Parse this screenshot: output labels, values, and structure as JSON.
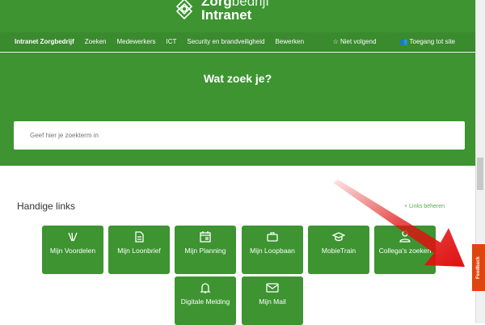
{
  "header": {
    "logo_bold": "Zorg",
    "logo_light": "bedrijf",
    "logo_line2": "Intranet"
  },
  "nav": {
    "brand": "Intranet Zorgbedrijf",
    "items": [
      "Zoeken",
      "Medewerkers",
      "ICT",
      "Security en brandveiligheid",
      "Bewerken"
    ],
    "follow": "Niet volgend",
    "access": "Toegang tot site"
  },
  "hero": {
    "title": "Wat zoek je?",
    "search_placeholder": "Geef hier je zoekterm in"
  },
  "links": {
    "title": "Handige links",
    "manage": "+ Links beheren",
    "tiles": [
      {
        "label": "Mijn Voordelen",
        "icon": "cards-icon"
      },
      {
        "label": "Mijn Loonbrief",
        "icon": "document-icon"
      },
      {
        "label": "Mijn Planning",
        "icon": "calendar-icon"
      },
      {
        "label": "Mijn Loopbaan",
        "icon": "briefcase-icon"
      },
      {
        "label": "MobieTrain",
        "icon": "graduation-cap-icon"
      },
      {
        "label": "Collega's zoeken",
        "icon": "person-icon"
      },
      {
        "label": "Digitale Melding",
        "icon": "bell-icon"
      },
      {
        "label": "Mijn Mail",
        "icon": "mail-icon"
      }
    ]
  },
  "feedback": "Feedback",
  "colors": {
    "brand_green": "#3d9431",
    "feedback": "#e0450f",
    "arrow": "#e01010"
  }
}
